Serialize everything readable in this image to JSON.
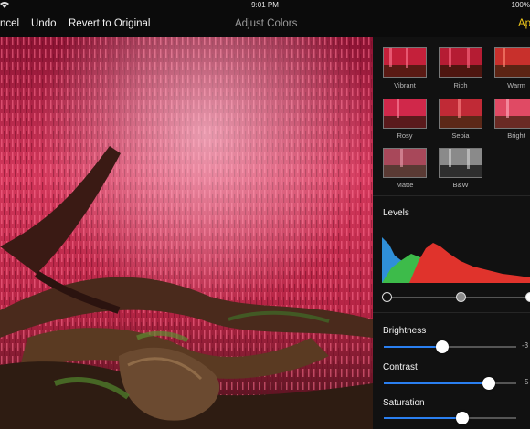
{
  "status": {
    "time": "9:01 PM",
    "battery": "100%"
  },
  "toolbar": {
    "cancel_label": "ncel",
    "undo_label": "Undo",
    "revert_label": "Revert to Original",
    "title": "Adjust Colors",
    "apply_label": "Ap"
  },
  "presets": [
    {
      "label": "Vibrant"
    },
    {
      "label": "Rich"
    },
    {
      "label": "Warm"
    },
    {
      "label": "Rosy"
    },
    {
      "label": "Sepia"
    },
    {
      "label": "Bright"
    },
    {
      "label": "Matte"
    },
    {
      "label": "B&W"
    }
  ],
  "levels": {
    "label": "Levels"
  },
  "adjustments": {
    "brightness": {
      "label": "Brightness",
      "value": "-3",
      "fraction": 0.44
    },
    "contrast": {
      "label": "Contrast",
      "value": "5",
      "fraction": 0.79
    },
    "saturation": {
      "label": "Saturation",
      "fraction": 0.59
    }
  },
  "colors": {
    "accent": "#2a7ff0",
    "apply": "#f0c81a"
  }
}
